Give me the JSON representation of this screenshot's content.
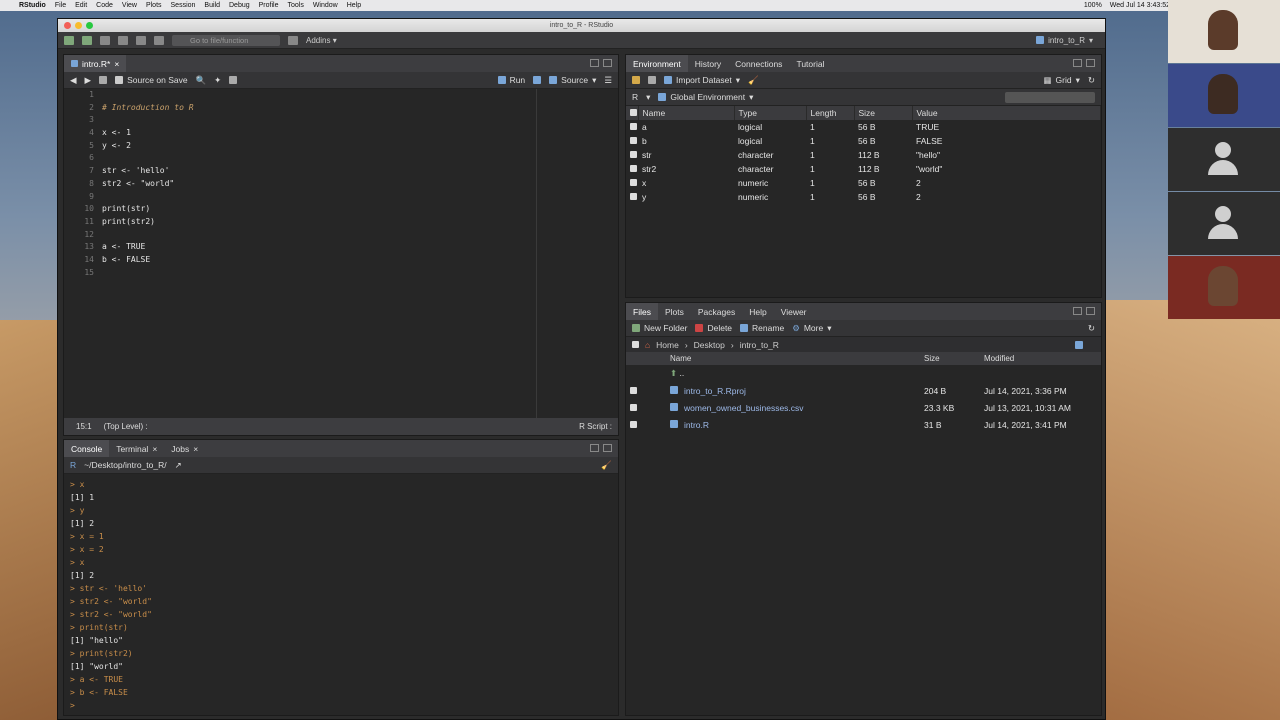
{
  "menubar": {
    "app": "RStudio",
    "items": [
      "File",
      "Edit",
      "Code",
      "View",
      "Plots",
      "Session",
      "Build",
      "Debug",
      "Profile",
      "Tools",
      "Window",
      "Help"
    ],
    "battery": "100%",
    "clock": "Wed Jul 14  3:43:52"
  },
  "window": {
    "title": "intro_to_R - RStudio"
  },
  "toolbar": {
    "goto_placeholder": "Go to file/function",
    "addins": "Addins",
    "project": "intro_to_R"
  },
  "editor": {
    "tab": "intro.R*",
    "source_on_save": "Source on Save",
    "run": "Run",
    "source": "Source",
    "lines": [
      {
        "n": "1",
        "t": ""
      },
      {
        "n": "2",
        "t": "# Introduction to R"
      },
      {
        "n": "3",
        "t": ""
      },
      {
        "n": "4",
        "t": "x <- 1"
      },
      {
        "n": "5",
        "t": "y <- 2"
      },
      {
        "n": "6",
        "t": ""
      },
      {
        "n": "7",
        "t": "str <- 'hello'"
      },
      {
        "n": "8",
        "t": "str2 <- \"world\""
      },
      {
        "n": "9",
        "t": ""
      },
      {
        "n": "10",
        "t": "print(str)"
      },
      {
        "n": "11",
        "t": "print(str2)"
      },
      {
        "n": "12",
        "t": ""
      },
      {
        "n": "13",
        "t": "a <- TRUE"
      },
      {
        "n": "14",
        "t": "b <- FALSE"
      },
      {
        "n": "15",
        "t": ""
      }
    ],
    "status_pos": "15:1",
    "status_scope": "(Top Level) :",
    "status_type": "R Script :"
  },
  "console": {
    "tabs": [
      "Console",
      "Terminal",
      "Jobs"
    ],
    "path": "~/Desktop/intro_to_R/",
    "lines": [
      {
        "k": "in",
        "t": "> x"
      },
      {
        "k": "out",
        "t": "[1] 1"
      },
      {
        "k": "in",
        "t": "> y"
      },
      {
        "k": "out",
        "t": "[1] 2"
      },
      {
        "k": "in",
        "t": "> x = 1"
      },
      {
        "k": "in",
        "t": "> x = 2"
      },
      {
        "k": "in",
        "t": "> x"
      },
      {
        "k": "out",
        "t": "[1] 2"
      },
      {
        "k": "in",
        "t": "> str <- 'hello'"
      },
      {
        "k": "in",
        "t": "> str2 <- \"world\""
      },
      {
        "k": "in",
        "t": "> str2 <- \"world\""
      },
      {
        "k": "in",
        "t": "> print(str)"
      },
      {
        "k": "out",
        "t": "[1] \"hello\""
      },
      {
        "k": "in",
        "t": "> print(str2)"
      },
      {
        "k": "out",
        "t": "[1] \"world\""
      },
      {
        "k": "in",
        "t": "> a <- TRUE"
      },
      {
        "k": "in",
        "t": "> b <- FALSE"
      },
      {
        "k": "in",
        "t": "> "
      }
    ]
  },
  "env": {
    "tabs": [
      "Environment",
      "History",
      "Connections",
      "Tutorial"
    ],
    "import_dataset": "Import Dataset",
    "grid": "Grid",
    "r_label": "R",
    "scope": "Global Environment",
    "columns": [
      "Name",
      "Type",
      "Length",
      "Size",
      "Value"
    ],
    "rows": [
      [
        "a",
        "logical",
        "1",
        "56 B",
        "TRUE"
      ],
      [
        "b",
        "logical",
        "1",
        "56 B",
        "FALSE"
      ],
      [
        "str",
        "character",
        "1",
        "112 B",
        "\"hello\""
      ],
      [
        "str2",
        "character",
        "1",
        "112 B",
        "\"world\""
      ],
      [
        "x",
        "numeric",
        "1",
        "56 B",
        "2"
      ],
      [
        "y",
        "numeric",
        "1",
        "56 B",
        "2"
      ]
    ]
  },
  "files": {
    "tabs": [
      "Files",
      "Plots",
      "Packages",
      "Help",
      "Viewer"
    ],
    "actions": [
      "New Folder",
      "Delete",
      "Rename",
      "More"
    ],
    "breadcrumb": [
      "Home",
      "Desktop",
      "intro_to_R"
    ],
    "columns": [
      "Name",
      "Size",
      "Modified"
    ],
    "up": "..",
    "rows": [
      [
        "intro_to_R.Rproj",
        "204 B",
        "Jul 14, 2021, 3:36 PM"
      ],
      [
        "women_owned_businesses.csv",
        "23.3 KB",
        "Jul 13, 2021, 10:31 AM"
      ],
      [
        "intro.R",
        "31 B",
        "Jul 14, 2021, 3:41 PM"
      ]
    ]
  }
}
